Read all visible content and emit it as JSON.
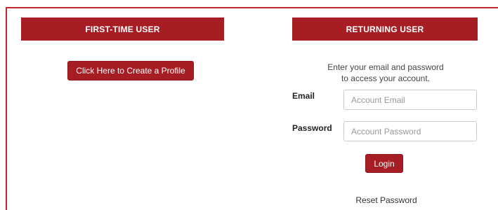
{
  "first_time": {
    "header": "FIRST-TIME USER",
    "create_button": "Click Here to Create a Profile"
  },
  "returning": {
    "header": "RETURNING USER",
    "intro_line1": "Enter your email and password",
    "intro_line2": "to access your account.",
    "email_label": "Email",
    "email_placeholder": "Account Email",
    "password_label": "Password",
    "password_placeholder": "Account Password",
    "login_button": "Login",
    "reset_link": "Reset Password"
  },
  "colors": {
    "brand_red": "#a71d24",
    "frame_red": "#c1272d"
  }
}
